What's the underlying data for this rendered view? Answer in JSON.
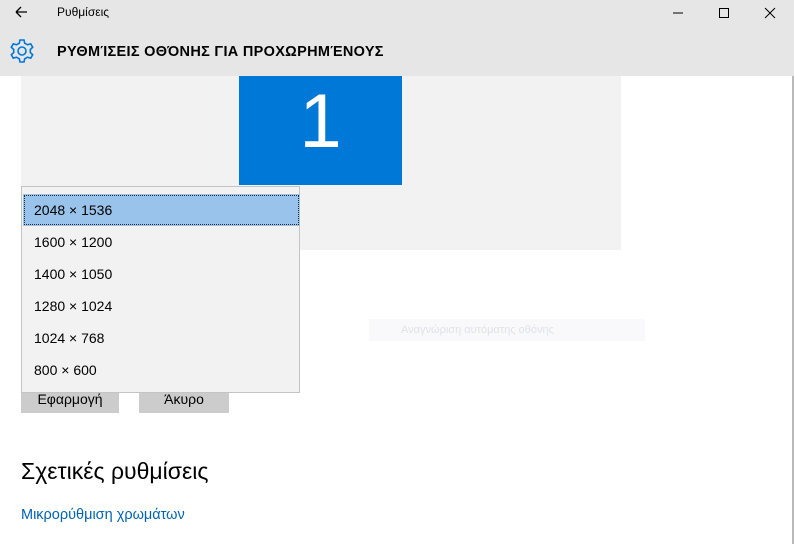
{
  "window": {
    "title": "Ρυθμίσεις"
  },
  "header": {
    "title": "ΡΥΘΜΊΣΕΙΣ ΟΘΌΝΗΣ ΓΙΑ ΠΡΟΧΩΡΗΜΈΝΟΥΣ",
    "icon": "gear-icon"
  },
  "preview": {
    "monitor_number": "1",
    "faint_text": "Αναγνώριση αυτόματης οθόνης"
  },
  "resolution_dropdown": {
    "selected": "2048 × 1536",
    "options": [
      "2048 × 1536",
      "1600 × 1200",
      "1400 × 1050",
      "1280 × 1024",
      "1024 × 768",
      "800 × 600"
    ]
  },
  "buttons": {
    "apply": "Εφαρμογή",
    "cancel": "Άκυρο"
  },
  "related": {
    "heading": "Σχετικές ρυθμίσεις",
    "color_link": "Μικρορύθμιση χρωμάτων"
  },
  "colors": {
    "accent": "#0078d7",
    "link": "#0063b1",
    "selected": "#99c3ea",
    "chrome": "#e6e6e6"
  }
}
